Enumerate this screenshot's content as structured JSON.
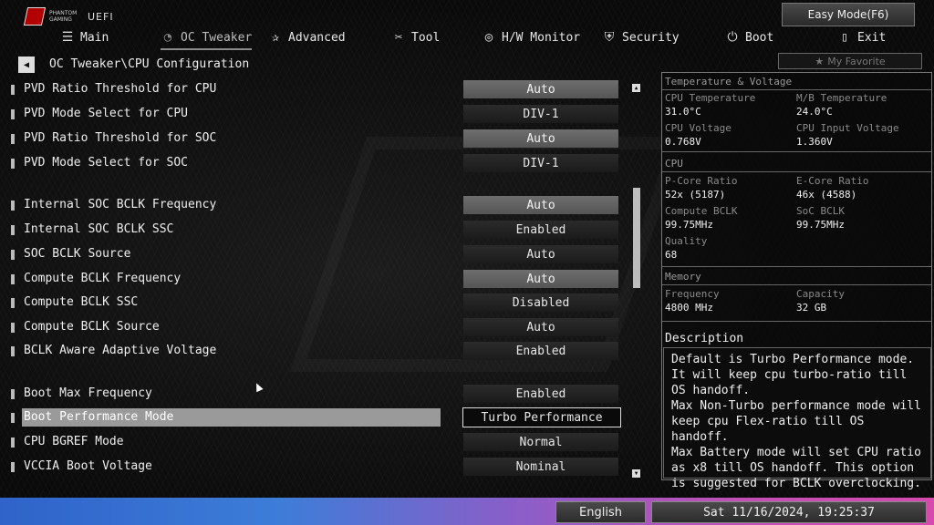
{
  "header": {
    "logo_text": "PHANTOM GAMING",
    "logo_uefi": "UEFI",
    "easy_mode_label": "Easy Mode(F6)"
  },
  "nav": {
    "items": [
      {
        "label": "Main",
        "icon": "list-icon"
      },
      {
        "label": "OC Tweaker",
        "icon": "speedometer-icon",
        "active": true
      },
      {
        "label": "Advanced",
        "icon": "star-icon"
      },
      {
        "label": "Tool",
        "icon": "tools-icon"
      },
      {
        "label": "H/W Monitor",
        "icon": "monitor-icon"
      },
      {
        "label": "Security",
        "icon": "shield-icon"
      },
      {
        "label": "Boot",
        "icon": "power-icon"
      },
      {
        "label": "Exit",
        "icon": "exit-icon"
      }
    ]
  },
  "breadcrumb": "OC Tweaker\\CPU Configuration",
  "favorite_label": "My Favorite",
  "settings": [
    {
      "label": "PVD Ratio Threshold for CPU",
      "value": "Auto",
      "style": "hl"
    },
    {
      "label": "PVD Mode Select for CPU",
      "value": "DIV-1",
      "style": ""
    },
    {
      "label": "PVD Ratio Threshold for SOC",
      "value": "Auto",
      "style": "hl"
    },
    {
      "label": "PVD Mode Select for SOC",
      "value": "DIV-1",
      "style": ""
    },
    {
      "label": "Internal SOC BCLK Frequency",
      "value": "Auto",
      "style": "hl"
    },
    {
      "label": "Internal SOC BCLK SSC",
      "value": "Enabled",
      "style": ""
    },
    {
      "label": "SOC BCLK Source",
      "value": "Auto",
      "style": ""
    },
    {
      "label": "Compute BCLK Frequency",
      "value": "Auto",
      "style": "hl"
    },
    {
      "label": "Compute BCLK SSC",
      "value": "Disabled",
      "style": ""
    },
    {
      "label": "Compute BCLK Source",
      "value": "Auto",
      "style": ""
    },
    {
      "label": "BCLK Aware Adaptive Voltage",
      "value": "Enabled",
      "style": ""
    },
    {
      "label": "Boot Max Frequency",
      "value": "Enabled",
      "style": ""
    },
    {
      "label": "Boot Performance Mode",
      "value": "Turbo Performance",
      "style": "sel",
      "selected": true
    },
    {
      "label": "CPU BGREF Mode",
      "value": "Normal",
      "style": ""
    },
    {
      "label": "VCCIA Boot Voltage",
      "value": "Nominal",
      "style": ""
    }
  ],
  "panel": {
    "temp_title": "Temperature & Voltage",
    "cpu_temp_label": "CPU Temperature",
    "cpu_temp": "31.0°C",
    "mb_temp_label": "M/B Temperature",
    "mb_temp": "24.0°C",
    "cpu_volt_label": "CPU Voltage",
    "cpu_volt": "0.768V",
    "cpu_input_label": "CPU Input Voltage",
    "cpu_input": "1.360V",
    "cpu_title": "CPU",
    "pcore_label": "P-Core Ratio",
    "pcore": "52x (5187)",
    "ecore_label": "E-Core Ratio",
    "ecore": "46x (4588)",
    "compute_bclk_label": "Compute BCLK",
    "compute_bclk": "99.75MHz",
    "soc_bclk_label": "SoC BCLK",
    "soc_bclk": "99.75MHz",
    "quality_label": "Quality",
    "quality": "68",
    "memory_title": "Memory",
    "freq_label": "Frequency",
    "freq": "4800 MHz",
    "cap_label": "Capacity",
    "cap": "32 GB",
    "desc_title": "Description",
    "desc_text": "Default is Turbo Performance mode. It will keep cpu turbo-ratio till OS handoff.\nMax Non-Turbo performance mode will keep cpu Flex-ratio till OS handoff.\nMax Battery mode will set CPU ratio as x8 till OS handoff. This option is suggested for BCLK overclocking."
  },
  "footer": {
    "language": "English",
    "datetime": "Sat 11/16/2024, 19:25:37"
  }
}
